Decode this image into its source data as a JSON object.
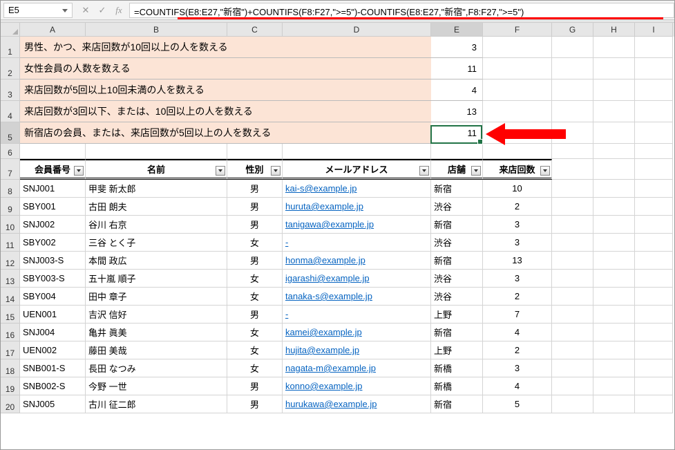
{
  "nameBox": "E5",
  "formula": "=COUNTIFS(E8:E27,\"新宿\")+COUNTIFS(F8:F27,\">=5\")-COUNTIFS(E8:E27,\"新宿\",F8:F27,\">=5\")",
  "columns": [
    "A",
    "B",
    "C",
    "D",
    "E",
    "F",
    "G",
    "H",
    "I"
  ],
  "summary": [
    {
      "label": "男性、かつ、来店回数が10回以上の人を数える",
      "value": "3"
    },
    {
      "label": "女性会員の人数を数える",
      "value": "11"
    },
    {
      "label": "来店回数が5回以上10回未満の人を数える",
      "value": "4"
    },
    {
      "label": "来店回数が3回以下、または、10回以上の人を数える",
      "value": "13"
    },
    {
      "label": "新宿店の会員、または、来店回数が5回以上の人を数える",
      "value": "11"
    }
  ],
  "tableHeaders": [
    "会員番号",
    "名前",
    "性別",
    "メールアドレス",
    "店舗",
    "来店回数"
  ],
  "tableRows": [
    {
      "id": "SNJ001",
      "name": "甲斐 新太郎",
      "sex": "男",
      "mail": "kai-s@example.jp",
      "shop": "新宿",
      "visits": "10"
    },
    {
      "id": "SBY001",
      "name": "古田 朗夫",
      "sex": "男",
      "mail": "huruta@example.jp",
      "shop": "渋谷",
      "visits": "2"
    },
    {
      "id": "SNJ002",
      "name": "谷川 右京",
      "sex": "男",
      "mail": "tanigawa@example.jp",
      "shop": "新宿",
      "visits": "3"
    },
    {
      "id": "SBY002",
      "name": "三谷 とく子",
      "sex": "女",
      "mail": "-",
      "shop": "渋谷",
      "visits": "3"
    },
    {
      "id": "SNJ003-S",
      "name": "本間 政広",
      "sex": "男",
      "mail": "honma@example.jp",
      "shop": "新宿",
      "visits": "13"
    },
    {
      "id": "SBY003-S",
      "name": "五十嵐 順子",
      "sex": "女",
      "mail": "igarashi@example.jp",
      "shop": "渋谷",
      "visits": "3"
    },
    {
      "id": "SBY004",
      "name": "田中 章子",
      "sex": "女",
      "mail": "tanaka-s@example.jp",
      "shop": "渋谷",
      "visits": "2"
    },
    {
      "id": "UEN001",
      "name": "吉沢 信好",
      "sex": "男",
      "mail": "-",
      "shop": "上野",
      "visits": "7"
    },
    {
      "id": "SNJ004",
      "name": "亀井 眞美",
      "sex": "女",
      "mail": "kamei@example.jp",
      "shop": "新宿",
      "visits": "4"
    },
    {
      "id": "UEN002",
      "name": "藤田 美哉",
      "sex": "女",
      "mail": "hujita@example.jp",
      "shop": "上野",
      "visits": "2"
    },
    {
      "id": "SNB001-S",
      "name": "長田 なつみ",
      "sex": "女",
      "mail": "nagata-m@example.jp",
      "shop": "新橋",
      "visits": "3"
    },
    {
      "id": "SNB002-S",
      "name": "今野 一世",
      "sex": "男",
      "mail": "konno@example.jp",
      "shop": "新橋",
      "visits": "4"
    },
    {
      "id": "SNJ005",
      "name": "古川 征二郎",
      "sex": "男",
      "mail": "hurukawa@example.jp",
      "shop": "新宿",
      "visits": "5"
    }
  ],
  "icons": {
    "cancel": "✕",
    "enter": "✓"
  }
}
